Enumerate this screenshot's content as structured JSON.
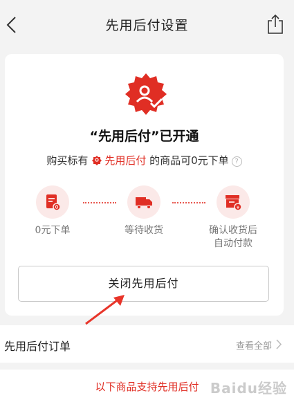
{
  "header": {
    "title": "先用后付设置"
  },
  "card": {
    "status_text": "“先用后付”已开通",
    "desc_prefix": "购买标有",
    "desc_brand": "先用后付",
    "desc_suffix": "的商品可0元下单",
    "help_symbol": "?",
    "steps": [
      {
        "label": "0元下单"
      },
      {
        "label": "等待收货"
      },
      {
        "label": "确认收货后\n自动付款"
      }
    ],
    "close_button_label": "关闭先用后付"
  },
  "orders": {
    "label": "先用后付订单",
    "view_all": "查看全部"
  },
  "support": {
    "text": "以下商品支持先用后付"
  },
  "watermark": "Baidu经验",
  "colors": {
    "brand_red": "#e02e24",
    "icon_bg": "#fbe9e8",
    "page_bg": "#f3f3f3"
  }
}
